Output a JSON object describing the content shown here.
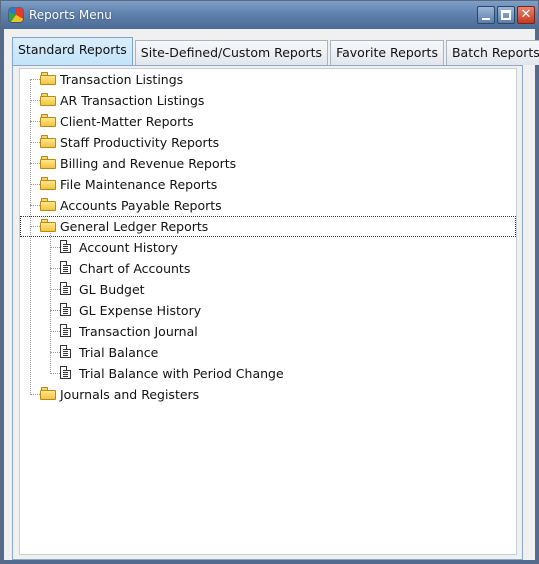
{
  "window": {
    "title": "Reports Menu"
  },
  "tabs": [
    {
      "label": "Standard Reports"
    },
    {
      "label": "Site-Defined/Custom Reports"
    },
    {
      "label": "Favorite Reports"
    },
    {
      "label": "Batch Reports"
    }
  ],
  "tree": {
    "items": [
      {
        "label": "Transaction Listings"
      },
      {
        "label": "AR Transaction Listings"
      },
      {
        "label": "Client-Matter Reports"
      },
      {
        "label": "Staff Productivity Reports"
      },
      {
        "label": "Billing and Revenue Reports"
      },
      {
        "label": "File Maintenance Reports"
      },
      {
        "label": "Accounts Payable Reports"
      },
      {
        "label": "General Ledger Reports",
        "children": [
          {
            "label": "Account History"
          },
          {
            "label": "Chart of Accounts"
          },
          {
            "label": "GL Budget"
          },
          {
            "label": "GL Expense History"
          },
          {
            "label": "Transaction Journal"
          },
          {
            "label": "Trial Balance"
          },
          {
            "label": "Trial Balance with Period Change"
          }
        ]
      },
      {
        "label": "Journals and Registers"
      }
    ]
  }
}
